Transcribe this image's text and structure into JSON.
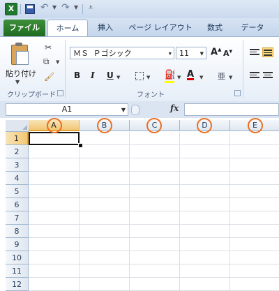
{
  "app": {
    "logo_letter": "X"
  },
  "quick_access": {
    "undo_icon": "undo-icon",
    "redo_icon": "redo-icon",
    "customize_icon": "dropdown-icon"
  },
  "tabs": [
    "ファイル",
    "ホーム",
    "挿入",
    "ページ レイアウト",
    "数式",
    "データ"
  ],
  "active_tab": "ホーム",
  "clipboard": {
    "paste_label": "貼り付け",
    "group_label": "クリップボード"
  },
  "font": {
    "name": "ＭＳ Ｐゴシック",
    "size": "11",
    "grow_label": "A",
    "shrink_label": "A",
    "bold_label": "B",
    "italic_label": "I",
    "underline_label": "U",
    "font_color_label": "A",
    "group_label": "フォント"
  },
  "formula_bar": {
    "name_box": "A1",
    "fx_label": "fx",
    "value": ""
  },
  "sheet": {
    "columns": [
      "A",
      "B",
      "C",
      "D",
      "E"
    ],
    "rows": [
      "1",
      "2",
      "3",
      "4",
      "5",
      "6",
      "7",
      "8",
      "9",
      "10",
      "11",
      "12"
    ],
    "selected_cell": "A1",
    "highlight_color": "#ee6d1e"
  },
  "colors": {
    "file_tab": "#2b7d2e",
    "selection": "#f2c773",
    "header": "#e0e7f0"
  }
}
